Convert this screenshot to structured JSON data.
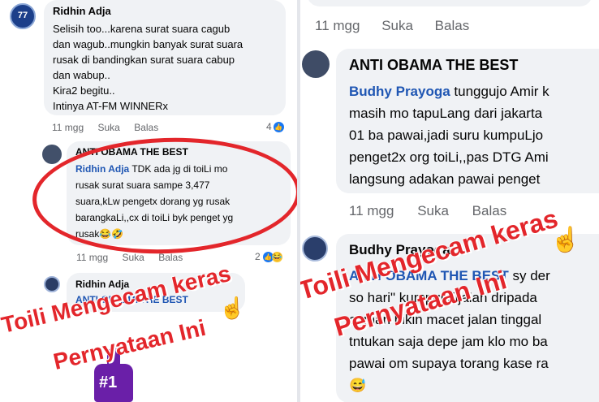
{
  "left": {
    "comment1": {
      "name": "Ridhin Adja",
      "avatar_badge": "77",
      "lines": [
        "Selisih too...karena surat suara cagub",
        "dan wagub..mungkin banyak surat suara",
        "rusak di bandingkan surat suara cabup",
        "dan wabup..",
        "Kira2 begitu..",
        "Intinya AT-FM WINNERx"
      ],
      "time": "11 mgg",
      "like": "Suka",
      "reply": "Balas",
      "reaction_count": "4"
    },
    "comment2": {
      "name": "ANTI  OBAMA THE BEST",
      "mention": "Ridhin Adja",
      "line1_rest": " TDK ada jg di toiLi mo",
      "lines": [
        "rusak surat suara sampe 3,477",
        "suara,kLw pengetx dorang yg rusak",
        "barangkaLi,,cx di toiLi byk penget yg"
      ],
      "last_line": "rusak",
      "emoji_text": "😂🤣",
      "time": "11 mgg",
      "like": "Suka",
      "reply": "Balas",
      "reaction_count": "2"
    },
    "comment3": {
      "name": "Ridhin Adja",
      "mention": "ANTI  OBAMA THE BEST"
    },
    "overlay": {
      "line1": "Toili Mengecam keras",
      "line2": "Pernyataan Ini"
    },
    "sticker_text": "#1"
  },
  "right": {
    "top_meta": {
      "time": "11 mgg",
      "like": "Suka",
      "reply": "Balas"
    },
    "comment1": {
      "name": "ANTI  OBAMA THE BEST",
      "mention": "Budhy Prayoga",
      "line1_rest": " tunggujo Amir k",
      "lines": [
        "masih mo tapuLang dari jakarta",
        "01 ba pawai,jadi suru kumpuLjo",
        "penget2x org toiLi,,pas DTG Ami",
        "langsung adakan pawai penget"
      ],
      "time": "11 mgg",
      "like": "Suka",
      "reply": "Balas"
    },
    "comment2": {
      "name": "Budhy Prayoga",
      "mention": "ANTI  OBAMA THE BEST",
      "line1_rest": " sy der",
      "lines": [
        "so hari\" kumpul dijalan dripada",
        "cuman bikin macet jalan tinggal",
        "tntukan saja depe jam klo mo ba",
        "pawai om supaya torang kase ra"
      ],
      "emoji_text": "😅"
    },
    "overlay": {
      "line1": "Toili Mengecam keras",
      "line2": "Pernyataan Ini"
    }
  },
  "colors": {
    "overlay_red": "#e3262b",
    "mention_blue": "#1f56b3",
    "bubble_gray": "#f0f2f5",
    "meta_gray": "#65676b"
  }
}
